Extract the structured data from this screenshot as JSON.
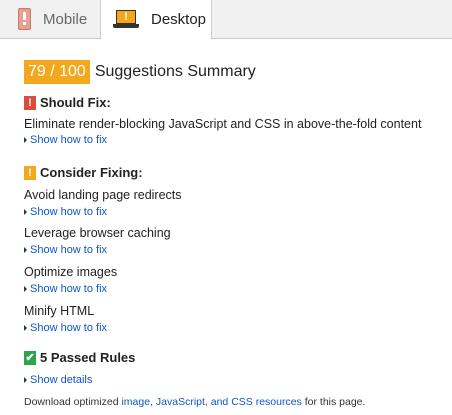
{
  "tabs": {
    "mobile_label": "Mobile",
    "desktop_label": "Desktop"
  },
  "score": {
    "value": "79 / 100",
    "title": "Suggestions Summary"
  },
  "should_fix": {
    "heading": "Should Fix:",
    "items": [
      {
        "label": "Eliminate render-blocking JavaScript and CSS in above-the-fold content",
        "link": "Show how to fix"
      }
    ]
  },
  "consider_fixing": {
    "heading": "Consider Fixing:",
    "items": [
      {
        "label": "Avoid landing page redirects",
        "link": "Show how to fix"
      },
      {
        "label": "Leverage browser caching",
        "link": "Show how to fix"
      },
      {
        "label": "Optimize images",
        "link": "Show how to fix"
      },
      {
        "label": "Minify HTML",
        "link": "Show how to fix"
      }
    ]
  },
  "passed": {
    "heading": "5 Passed Rules",
    "link": "Show details"
  },
  "footer": {
    "prefix": "Download optimized ",
    "link": "image, JavaScript, and CSS resources",
    "suffix": " for this page."
  },
  "colors": {
    "score_badge": "#f2a81d",
    "should_fix": "#dd4b39",
    "consider": "#f2a81d",
    "passed": "#2da44e",
    "link": "#1155cc"
  },
  "icons": {
    "mobile": "phone-icon",
    "desktop": "laptop-icon"
  }
}
